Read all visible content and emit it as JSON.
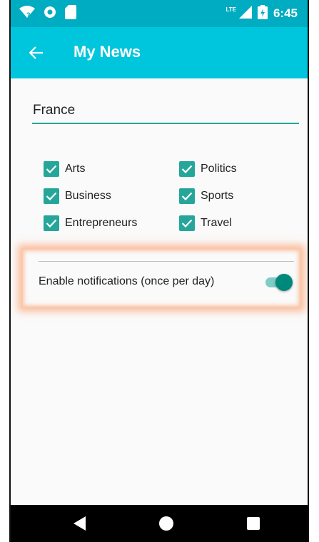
{
  "status_bar": {
    "network": "LTE",
    "time": "6:45",
    "icons": [
      "wifi-icon",
      "circle-notification-icon",
      "sd-card-icon",
      "signal-icon",
      "battery-icon"
    ]
  },
  "toolbar": {
    "back_icon": "arrow-left-icon",
    "title": "My News"
  },
  "country_input": {
    "value": "France"
  },
  "categories": [
    {
      "label": "Arts",
      "checked": true
    },
    {
      "label": "Politics",
      "checked": true
    },
    {
      "label": "Business",
      "checked": true
    },
    {
      "label": "Sports",
      "checked": true
    },
    {
      "label": "Entrepreneurs",
      "checked": true
    },
    {
      "label": "Travel",
      "checked": true
    }
  ],
  "notifications": {
    "label": "Enable notifications (once per day)",
    "enabled": true
  },
  "nav_bar": {
    "icons": [
      "back-triangle-icon",
      "home-circle-icon",
      "recents-square-icon"
    ]
  },
  "colors": {
    "status_bar": "#00acc1",
    "toolbar": "#00c6dd",
    "accent": "#26a69a",
    "switch_thumb": "#00897b",
    "highlight": "#f78c50"
  }
}
